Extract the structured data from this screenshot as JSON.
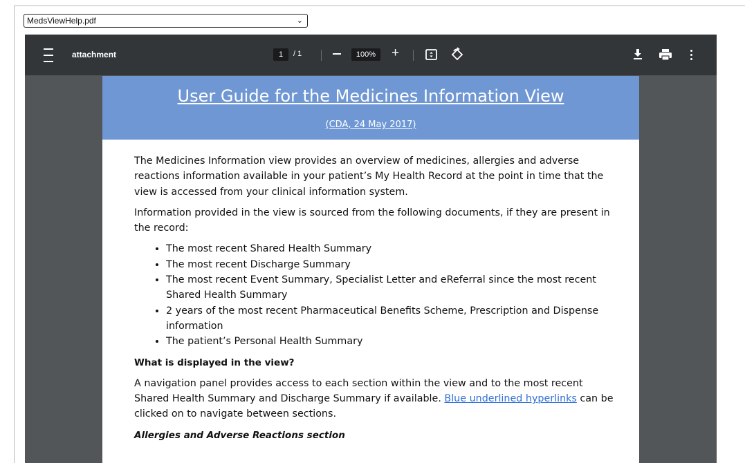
{
  "selector": {
    "value": "MedsViewHelp.pdf"
  },
  "toolbar": {
    "title": "attachment",
    "page_current": "1",
    "page_total": "/ 1",
    "zoom": "100%",
    "zoom_in_label": "+"
  },
  "document": {
    "header_title": "User Guide for the Medicines Information View",
    "header_sub": "(CDA, 24 May 2017)",
    "intro": "The Medicines Information view provides an overview of medicines, allergies and adverse reactions information available in your patient’s My Health Record at the point in time that the view is accessed from your clinical information system.",
    "sources_intro": "Information provided in the view is sourced from the following documents, if they are present in the record:",
    "sources": [
      "The most recent Shared Health Summary",
      "The most recent Discharge Summary",
      "The most recent Event Summary, Specialist Letter and eReferral since the most recent Shared Health Summary",
      "2 years of the most recent Pharmaceutical Benefits Scheme, Prescription and Dispense information",
      "The patient’s Personal Health Summary"
    ],
    "displayed_heading": "What is displayed in the view?",
    "nav_text_before": "A navigation panel provides access to each section within the view and to the most recent Shared Health Summary and Discharge Summary if available.  ",
    "nav_link": "Blue underlined hyperlinks",
    "nav_text_after": " can be clicked on to navigate between sections.",
    "allergies_heading": "Allergies and Adverse Reactions section"
  },
  "colors": {
    "toolbar_bg": "#323639",
    "viewer_bg": "#525659",
    "header_bg": "#6f97d4",
    "link": "#2f6fd6"
  }
}
